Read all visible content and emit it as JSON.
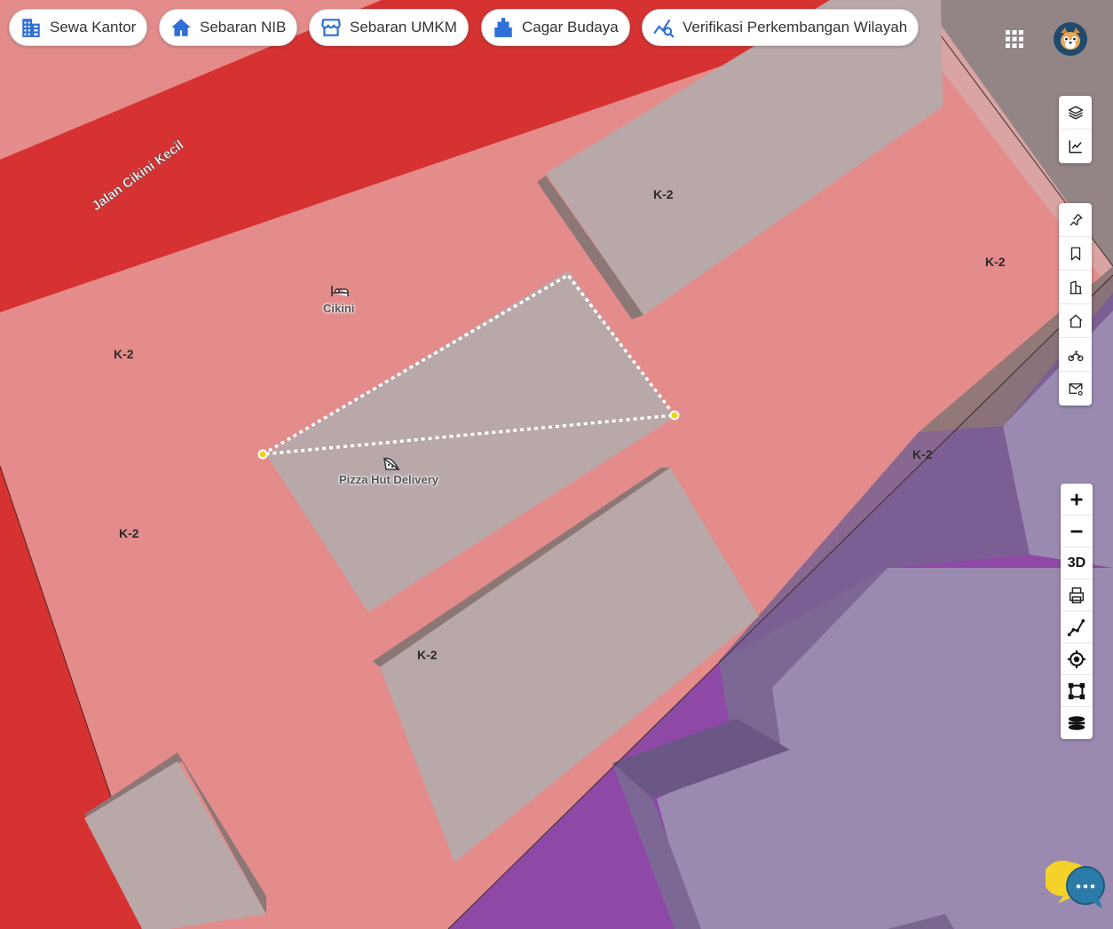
{
  "top_nav": [
    {
      "label": "Sewa Kantor",
      "icon": "office-building-icon"
    },
    {
      "label": "Sebaran NIB",
      "icon": "home-icon"
    },
    {
      "label": "Sebaran UMKM",
      "icon": "storefront-icon"
    },
    {
      "label": "Cagar Budaya",
      "icon": "heritage-building-icon"
    },
    {
      "label": "Verifikasi Perkembangan Wilayah",
      "icon": "chart-search-icon"
    }
  ],
  "header": {
    "apps_icon": "apps-grid-icon",
    "avatar": "user-avatar"
  },
  "map": {
    "road_label": "Jalan Cikini Kecil",
    "zone_code": "K-2",
    "poi": [
      {
        "label": "Cikini",
        "icon": "hotel-icon"
      },
      {
        "label": "Pizza Hut Delivery",
        "icon": "pizza-icon"
      }
    ],
    "colors": {
      "zone_commercial": "#e38c8b",
      "road": "#d63232",
      "zone_purple": "#8e49a6",
      "building": "#b8a8a8",
      "measure_line": "#ffffff",
      "measure_vertex": "#f2d21c"
    }
  },
  "tools_top": [
    {
      "icon": "layers-icon"
    },
    {
      "icon": "analytics-chart-icon"
    }
  ],
  "tools_mid": [
    {
      "icon": "pin-icon"
    },
    {
      "icon": "bookmark-icon"
    },
    {
      "icon": "buildings-icon"
    },
    {
      "icon": "house-icon"
    },
    {
      "icon": "motorbike-icon"
    },
    {
      "icon": "mail-settings-icon"
    }
  ],
  "map_controls": {
    "zoom_in": "+",
    "zoom_out": "−",
    "view_3d": "3D",
    "buttons": [
      "zoom-in-icon",
      "zoom-out-icon",
      "3d-toggle",
      "print-icon",
      "measure-distance-icon",
      "locate-icon",
      "measure-area-icon",
      "basemap-icon"
    ]
  },
  "chat_widget": {
    "icon": "chat-bubbles-icon"
  }
}
